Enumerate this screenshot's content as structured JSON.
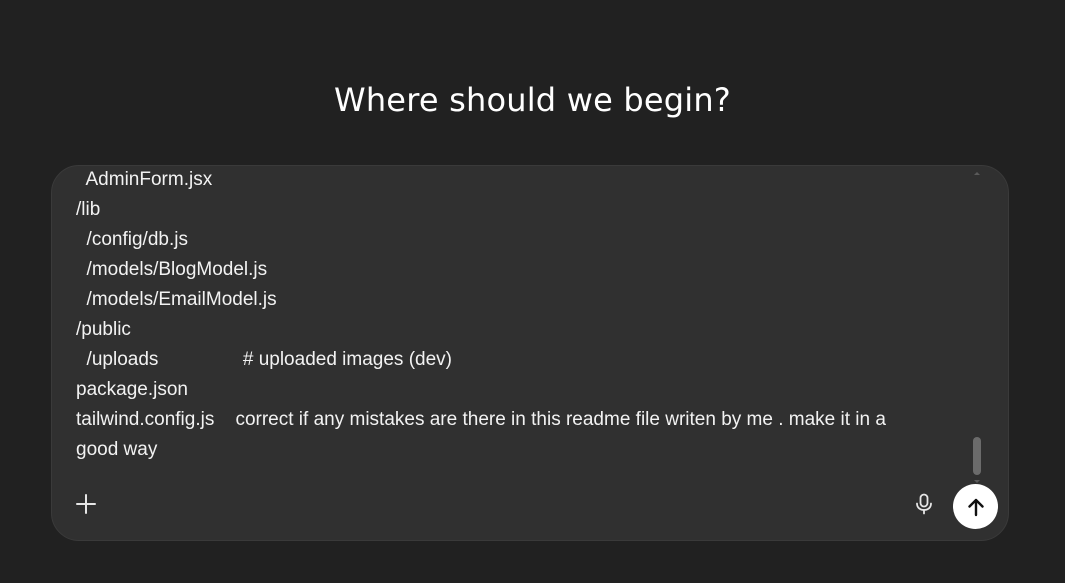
{
  "heading": "Where should we begin?",
  "composer": {
    "lines": [
      "  AdminForm.jsx",
      "/lib",
      "  /config/db.js",
      "  /models/BlogModel.js",
      "  /models/EmailModel.js",
      "/public",
      "  /uploads                # uploaded images (dev)",
      "package.json",
      "tailwind.config.js    correct if any mistakes are there in this readme file writen by me . make it in a",
      "good way"
    ],
    "icons": {
      "attach": "plus-icon",
      "voice": "microphone-icon",
      "send": "arrow-up-icon"
    }
  },
  "colors": {
    "background": "#212121",
    "composer": "#303030",
    "send_button": "#ffffff"
  }
}
